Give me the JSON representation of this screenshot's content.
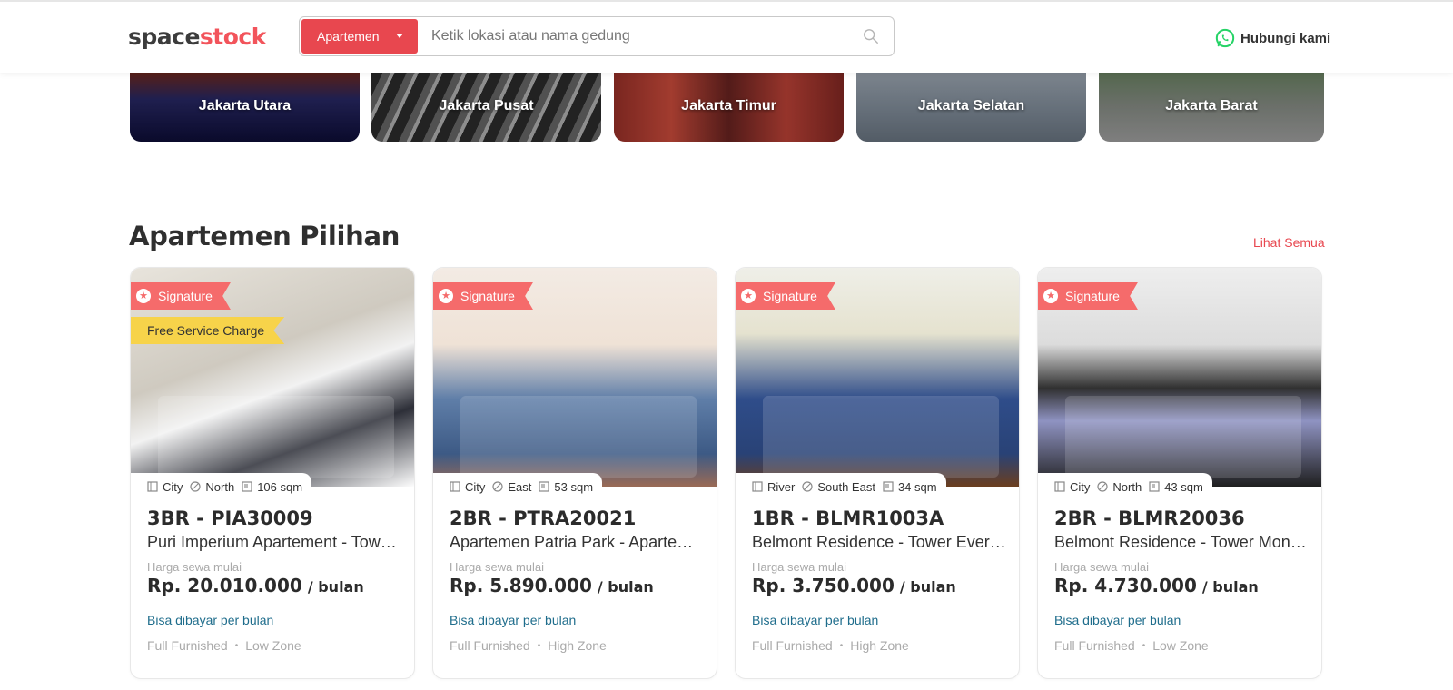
{
  "header": {
    "logo_part1": "space",
    "logo_part2": "stock",
    "search_type": "Apartemen",
    "search_placeholder": "Ketik lokasi atau nama gedung",
    "contact_label": "Hubungi kami"
  },
  "cities": [
    {
      "label": "Jakarta Utara"
    },
    {
      "label": "Jakarta Pusat"
    },
    {
      "label": "Jakarta Timur"
    },
    {
      "label": "Jakarta Selatan"
    },
    {
      "label": "Jakarta Barat"
    }
  ],
  "section": {
    "title": "Apartemen Pilihan",
    "see_all": "Lihat Semua"
  },
  "listings": [
    {
      "badge": "Signature",
      "promo": "Free Service Charge",
      "view": "City",
      "direction": "North",
      "size": "106 sqm",
      "code": "3BR - PIA30009",
      "name": "Puri Imperium Apartement - Tower...",
      "price_label": "Harga sewa mulai",
      "price": "Rp. 20.010.000",
      "price_unit": "/ bulan",
      "payment": "Bisa dibayar per bulan",
      "furnish": "Full Furnished",
      "zone": "Low Zone"
    },
    {
      "badge": "Signature",
      "view": "City",
      "direction": "East",
      "size": "53 sqm",
      "code": "2BR - PTRA20021",
      "name": "Apartemen Patria Park - Apartemen...",
      "price_label": "Harga sewa mulai",
      "price": "Rp. 5.890.000",
      "price_unit": "/ bulan",
      "payment": "Bisa dibayar per bulan",
      "furnish": "Full Furnished",
      "zone": "High Zone"
    },
    {
      "badge": "Signature",
      "view": "River",
      "direction": "South East",
      "size": "34 sqm",
      "code": "1BR - BLMR1003A",
      "name": "Belmont Residence - Tower Evergreen",
      "price_label": "Harga sewa mulai",
      "price": "Rp. 3.750.000",
      "price_unit": "/ bulan",
      "payment": "Bisa dibayar per bulan",
      "furnish": "Full Furnished",
      "zone": "High Zone"
    },
    {
      "badge": "Signature",
      "view": "City",
      "direction": "North",
      "size": "43 sqm",
      "code": "2BR - BLMR20036",
      "name": "Belmont Residence - Tower Montana",
      "price_label": "Harga sewa mulai",
      "price": "Rp. 4.730.000",
      "price_unit": "/ bulan",
      "payment": "Bisa dibayar per bulan",
      "furnish": "Full Furnished",
      "zone": "Low Zone"
    }
  ],
  "colors": {
    "brand_red": "#e8474f",
    "ribbon": "#f56b6b",
    "promo_yellow": "#f7d34a",
    "link_blue": "#1f6d8c",
    "whatsapp_green": "#25d366"
  },
  "icons": {
    "search": "search-icon",
    "contact": "whatsapp-icon",
    "view": "building-icon",
    "direction": "compass-icon",
    "size": "area-icon",
    "badge": "star-icon"
  }
}
